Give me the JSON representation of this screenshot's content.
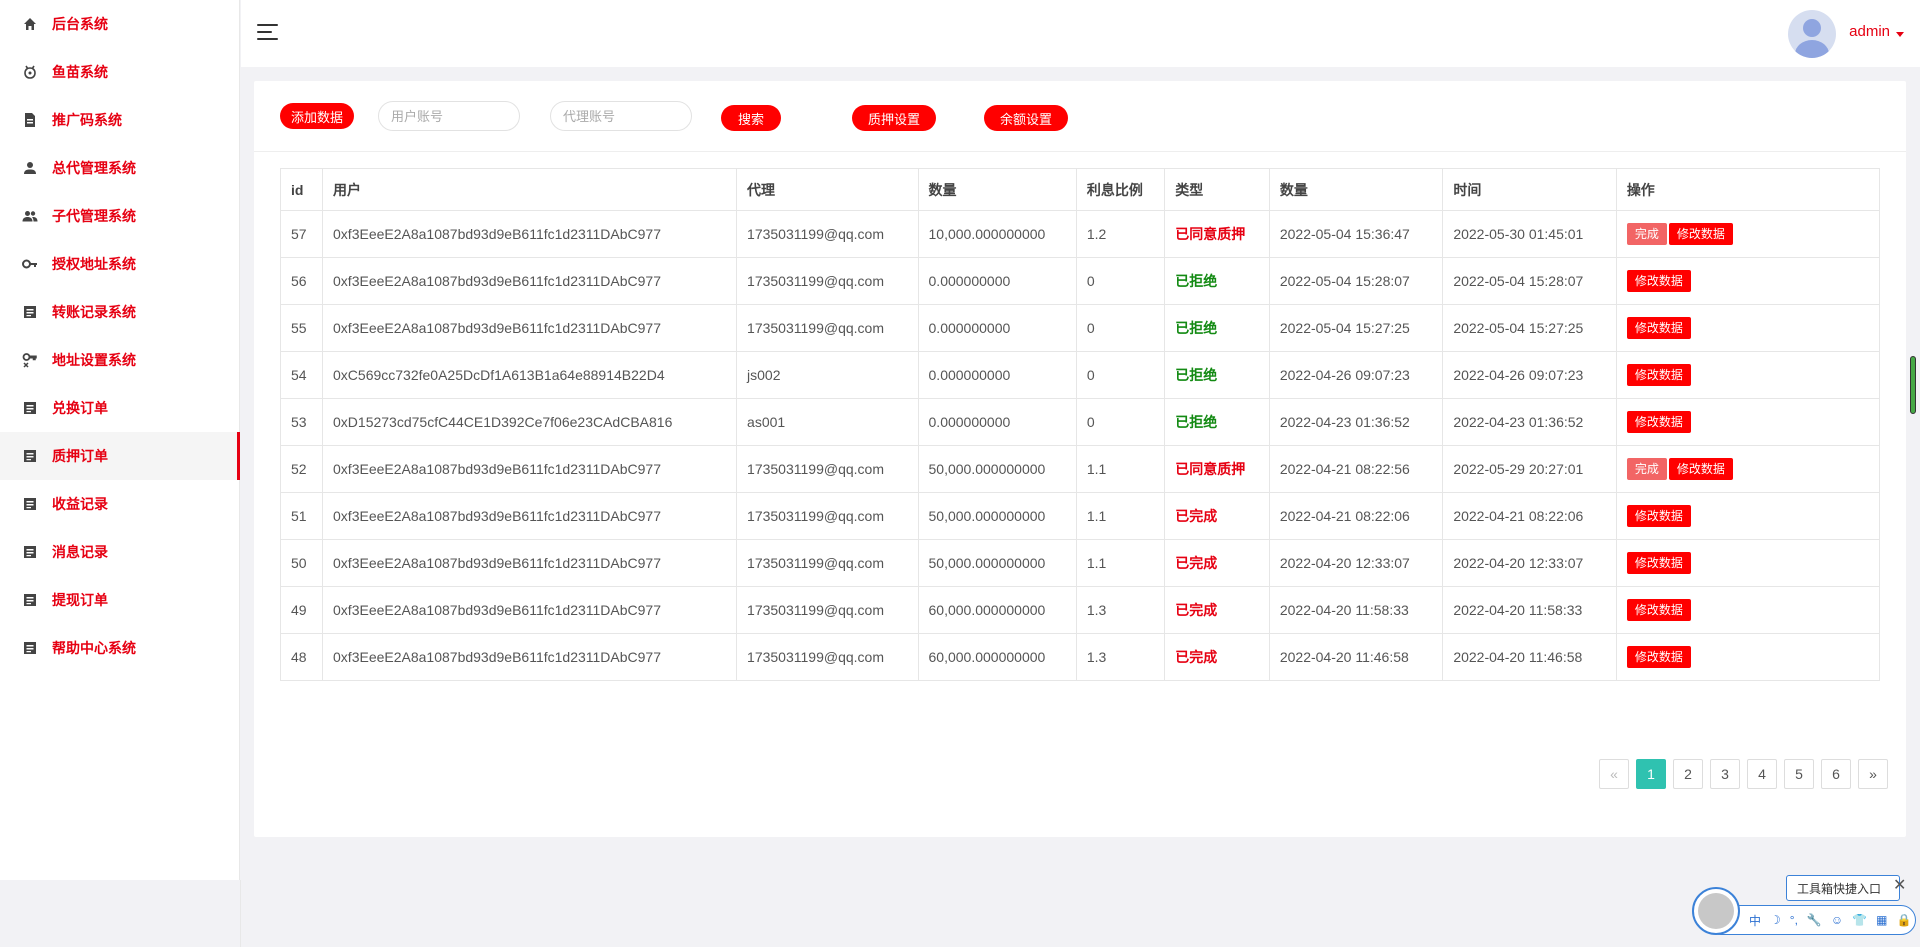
{
  "sidebar": {
    "items": [
      {
        "label": "后台系统",
        "icon": "home-icon"
      },
      {
        "label": "鱼苗系统",
        "icon": "fish-icon"
      },
      {
        "label": "推广码系统",
        "icon": "document-icon"
      },
      {
        "label": "总代管理系统",
        "icon": "person-icon"
      },
      {
        "label": "子代管理系统",
        "icon": "people-icon"
      },
      {
        "label": "授权地址系统",
        "icon": "key-icon"
      },
      {
        "label": "转账记录系统",
        "icon": "list-icon"
      },
      {
        "label": "地址设置系统",
        "icon": "settings-key-icon"
      },
      {
        "label": "兑换订单",
        "icon": "list-icon"
      },
      {
        "label": "质押订单",
        "icon": "list-icon"
      },
      {
        "label": "收益记录",
        "icon": "list-icon"
      },
      {
        "label": "消息记录",
        "icon": "list-icon"
      },
      {
        "label": "提现订单",
        "icon": "list-icon"
      },
      {
        "label": "帮助中心系统",
        "icon": "list-icon"
      }
    ],
    "active_index": 9
  },
  "header": {
    "user_name": "admin"
  },
  "toolbar": {
    "add_label": "添加数据",
    "user_placeholder": "用户账号",
    "agent_placeholder": "代理账号",
    "search_label": "搜索",
    "pledge_settings_label": "质押设置",
    "balance_settings_label": "余额设置"
  },
  "table": {
    "columns": [
      "id",
      "用户",
      "代理",
      "数量",
      "利息比例",
      "类型",
      "数量",
      "时间",
      "操作"
    ],
    "rows": [
      {
        "id": "57",
        "user": "0xf3EeeE2A8a1087bd93d9eB611fc1d2311DAbC977",
        "agent": "1735031199@qq.com",
        "amount": "10,000.000000000",
        "rate": "1.2",
        "type": "已同意质押",
        "type_color": "red",
        "time1": "2022-05-04 15:36:47",
        "time2": "2022-05-30 01:45:01",
        "done_label": "完成",
        "edit_label": "修改数据"
      },
      {
        "id": "56",
        "user": "0xf3EeeE2A8a1087bd93d9eB611fc1d2311DAbC977",
        "agent": "1735031199@qq.com",
        "amount": "0.000000000",
        "rate": "0",
        "type": "已拒绝",
        "type_color": "green",
        "time1": "2022-05-04 15:28:07",
        "time2": "2022-05-04 15:28:07",
        "done_label": "",
        "edit_label": "修改数据"
      },
      {
        "id": "55",
        "user": "0xf3EeeE2A8a1087bd93d9eB611fc1d2311DAbC977",
        "agent": "1735031199@qq.com",
        "amount": "0.000000000",
        "rate": "0",
        "type": "已拒绝",
        "type_color": "green",
        "time1": "2022-05-04 15:27:25",
        "time2": "2022-05-04 15:27:25",
        "done_label": "",
        "edit_label": "修改数据"
      },
      {
        "id": "54",
        "user": "0xC569cc732fe0A25DcDf1A613B1a64e88914B22D4",
        "agent": "js002",
        "amount": "0.000000000",
        "rate": "0",
        "type": "已拒绝",
        "type_color": "green",
        "time1": "2022-04-26 09:07:23",
        "time2": "2022-04-26 09:07:23",
        "done_label": "",
        "edit_label": "修改数据"
      },
      {
        "id": "53",
        "user": "0xD15273cd75cfC44CE1D392Ce7f06e23CAdCBA816",
        "agent": "as001",
        "amount": "0.000000000",
        "rate": "0",
        "type": "已拒绝",
        "type_color": "green",
        "time1": "2022-04-23 01:36:52",
        "time2": "2022-04-23 01:36:52",
        "done_label": "",
        "edit_label": "修改数据"
      },
      {
        "id": "52",
        "user": "0xf3EeeE2A8a1087bd93d9eB611fc1d2311DAbC977",
        "agent": "1735031199@qq.com",
        "amount": "50,000.000000000",
        "rate": "1.1",
        "type": "已同意质押",
        "type_color": "red",
        "time1": "2022-04-21 08:22:56",
        "time2": "2022-05-29 20:27:01",
        "done_label": "完成",
        "edit_label": "修改数据"
      },
      {
        "id": "51",
        "user": "0xf3EeeE2A8a1087bd93d9eB611fc1d2311DAbC977",
        "agent": "1735031199@qq.com",
        "amount": "50,000.000000000",
        "rate": "1.1",
        "type": "已完成",
        "type_color": "red",
        "time1": "2022-04-21 08:22:06",
        "time2": "2022-04-21 08:22:06",
        "done_label": "",
        "edit_label": "修改数据"
      },
      {
        "id": "50",
        "user": "0xf3EeeE2A8a1087bd93d9eB611fc1d2311DAbC977",
        "agent": "1735031199@qq.com",
        "amount": "50,000.000000000",
        "rate": "1.1",
        "type": "已完成",
        "type_color": "red",
        "time1": "2022-04-20 12:33:07",
        "time2": "2022-04-20 12:33:07",
        "done_label": "",
        "edit_label": "修改数据"
      },
      {
        "id": "49",
        "user": "0xf3EeeE2A8a1087bd93d9eB611fc1d2311DAbC977",
        "agent": "1735031199@qq.com",
        "amount": "60,000.000000000",
        "rate": "1.3",
        "type": "已完成",
        "type_color": "red",
        "time1": "2022-04-20 11:58:33",
        "time2": "2022-04-20 11:58:33",
        "done_label": "",
        "edit_label": "修改数据"
      },
      {
        "id": "48",
        "user": "0xf3EeeE2A8a1087bd93d9eB611fc1d2311DAbC977",
        "agent": "1735031199@qq.com",
        "amount": "60,000.000000000",
        "rate": "1.3",
        "type": "已完成",
        "type_color": "red",
        "time1": "2022-04-20 11:46:58",
        "time2": "2022-04-20 11:46:58",
        "done_label": "",
        "edit_label": "修改数据"
      }
    ]
  },
  "pagination": {
    "prev": "«",
    "next": "»",
    "pages": [
      "1",
      "2",
      "3",
      "4",
      "5",
      "6"
    ],
    "current": "1"
  },
  "toolbox": {
    "tip": "工具箱快捷入口",
    "close": "✕",
    "icons": [
      "中",
      "☽",
      "°,",
      "🔧",
      "☺",
      "👕",
      "▦",
      "🔒"
    ]
  },
  "colors": {
    "accent": "#e60012",
    "button_red": "#ff0000",
    "page_active": "#2fc2b0",
    "status_green": "#138a13"
  }
}
